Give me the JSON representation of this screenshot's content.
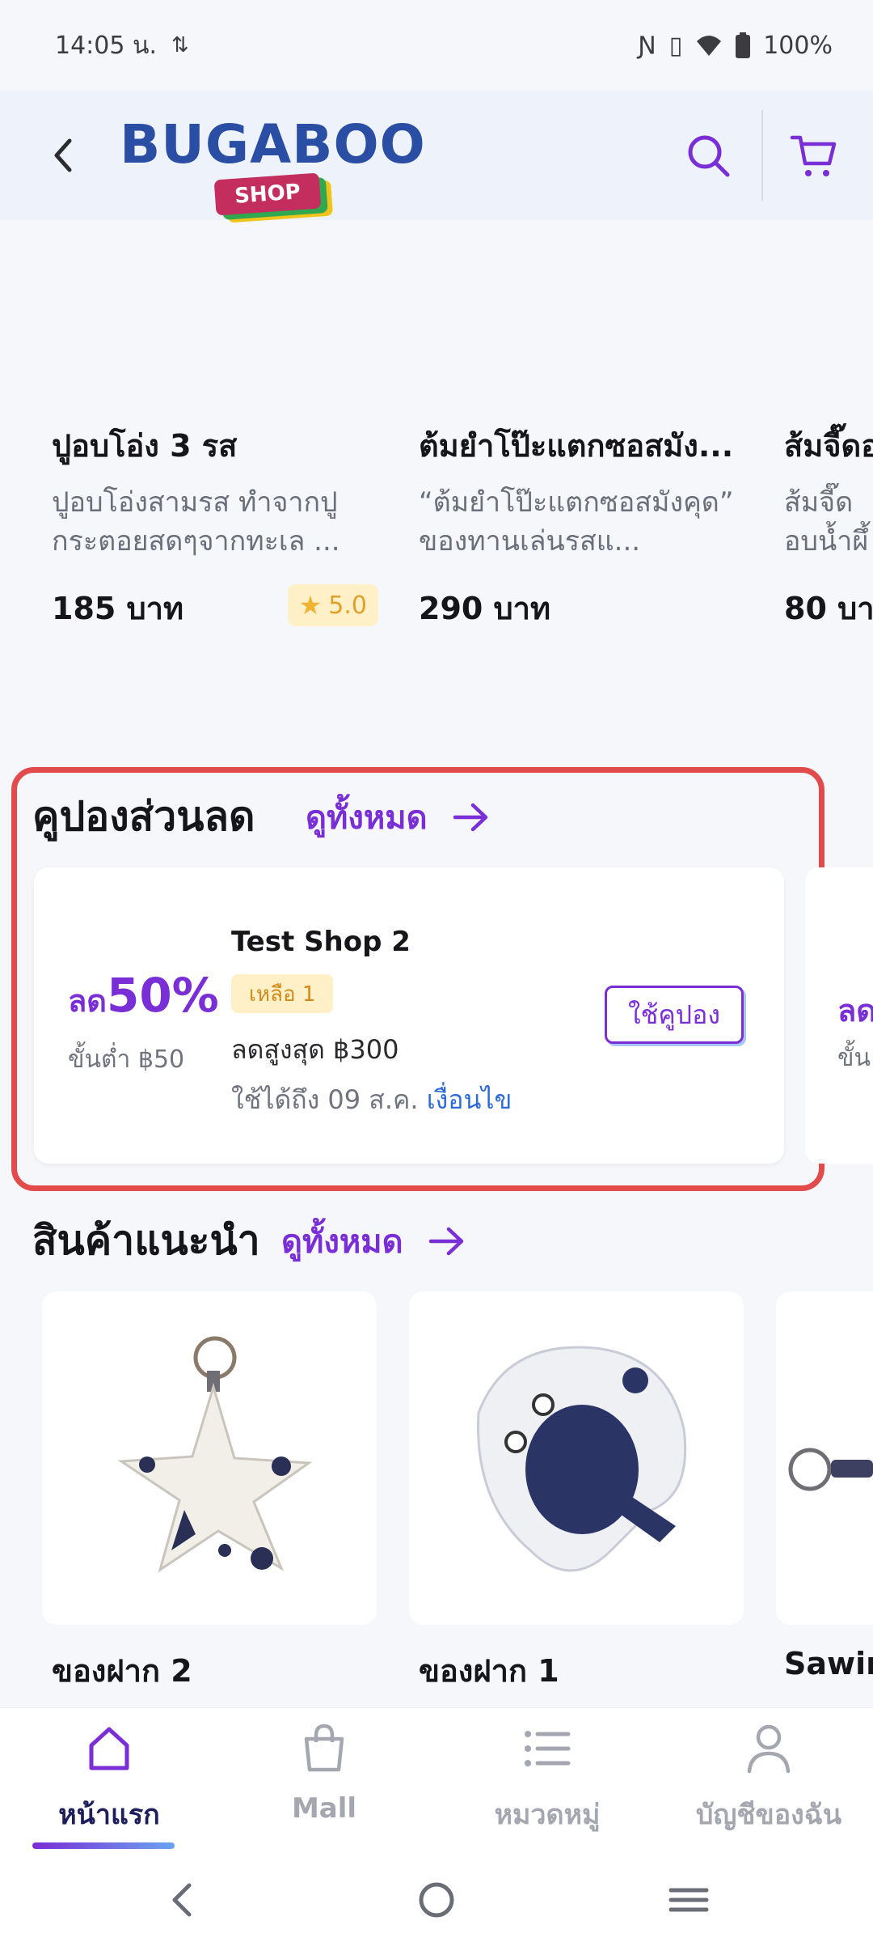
{
  "status_bar": {
    "time": "14:05 น.",
    "battery": "100%"
  },
  "app_bar": {
    "logo_text": "BUGABOO",
    "logo_tag": "SHOP"
  },
  "product_strip": [
    {
      "name": "ปูอบโอ่ง 3 รส",
      "desc": "ปูอบโอ่งสามรส ทำจากปูกระตอยสดๆจากทะเล ...",
      "price": "185 บาท",
      "rating": "5.0"
    },
    {
      "name": "ต้มยำโป๊ะแตกซอสมัง...",
      "desc": "“ต้มยำโป๊ะแตกซอสมังคุด” ของทานเล่นรสแ...",
      "price": "290 บาท"
    },
    {
      "name": "ส้มจี๊ดอ",
      "desc": "ส้มจี๊ดอบน้ำผึ้",
      "price": "80 บา"
    }
  ],
  "coupons": {
    "title": "คูปองส่วนลด",
    "see_all": "ดูทั้งหมด",
    "card": {
      "discount_prefix": "ลด",
      "discount_value": "50%",
      "minimum": "ขั้นต่ำ ฿50",
      "shop": "Test Shop 2",
      "remaining": "เหลือ 1",
      "max_discount": "ลดสูงสุด ฿300",
      "valid_until": "ใช้ได้ถึง 09 ส.ค.",
      "conditions": "เงื่อนไข",
      "use_button": "ใช้คูปอง"
    },
    "peek": {
      "discount_prefix": "ลด",
      "minimum": "ขั้น"
    }
  },
  "recommended": {
    "title": "สินค้าแนะนำ",
    "see_all": "ดูทั้งหมด",
    "items": [
      {
        "name": "ของฝาก 2"
      },
      {
        "name": "ของฝาก 1"
      },
      {
        "name": "Sawin"
      }
    ]
  },
  "bottom_nav": {
    "items": [
      {
        "label": "หน้าแรก",
        "icon": "home-icon"
      },
      {
        "label": "Mall",
        "icon": "shopping-bag-icon"
      },
      {
        "label": "หมวดหมู่",
        "icon": "list-icon"
      },
      {
        "label": "บัญชีของฉัน",
        "icon": "user-icon"
      }
    ]
  },
  "colors": {
    "accent": "#7a2ed6",
    "highlight_frame": "#e24b4b",
    "brand_blue": "#2a4ea3",
    "rating_bg": "#fff0c7",
    "link_blue": "#2f6bd8"
  }
}
